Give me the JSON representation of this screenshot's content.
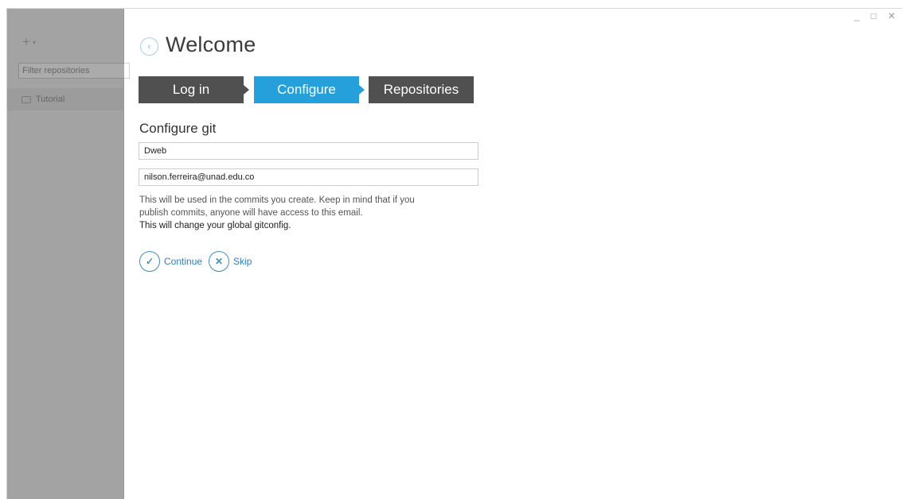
{
  "window": {
    "controls": [
      "_",
      "□",
      "✕"
    ]
  },
  "sidebar": {
    "add_icon": "+",
    "add_caret": "▾",
    "filter_placeholder": "Filter repositories",
    "repositories": [
      {
        "label": "Tutorial"
      }
    ]
  },
  "welcome": {
    "back_icon": "‹",
    "title": "Welcome",
    "steps": {
      "login": "Log in",
      "configure": "Configure",
      "repositories": "Repositories"
    },
    "active_step": "configure"
  },
  "configure": {
    "title": "Configure git",
    "name_value": "Dweb",
    "email_value": "nilson.ferreira@unad.edu.co",
    "help_line1": "This will be used in the commits you create. Keep in mind that if you",
    "help_line2": "publish commits, anyone will have access to this email.",
    "help_line3": "This will change your global gitconfig.",
    "continue_label": "Continue",
    "continue_icon": "✓",
    "skip_label": "Skip",
    "skip_icon": "✕"
  },
  "colors": {
    "step_active": "#26a0da",
    "step_inactive": "#505050",
    "link": "#2f7fb8"
  }
}
